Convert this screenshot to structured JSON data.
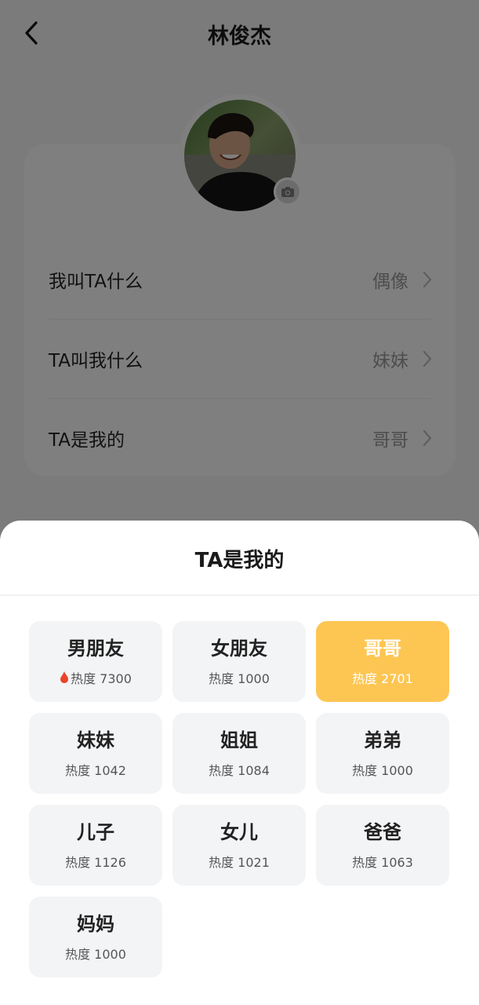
{
  "header": {
    "title": "林俊杰"
  },
  "profile": {
    "rows": [
      {
        "label": "我叫TA什么",
        "value": "偶像"
      },
      {
        "label": "TA叫我什么",
        "value": "妹妹"
      },
      {
        "label": "TA是我的",
        "value": "哥哥"
      }
    ]
  },
  "sheet": {
    "title": "TA是我的",
    "options": [
      {
        "name": "男朋友",
        "heat": "热度 7300",
        "hot": true,
        "selected": false
      },
      {
        "name": "女朋友",
        "heat": "热度 1000",
        "hot": false,
        "selected": false
      },
      {
        "name": "哥哥",
        "heat": "热度 2701",
        "hot": false,
        "selected": true
      },
      {
        "name": "妹妹",
        "heat": "热度 1042",
        "hot": false,
        "selected": false
      },
      {
        "name": "姐姐",
        "heat": "热度 1084",
        "hot": false,
        "selected": false
      },
      {
        "name": "弟弟",
        "heat": "热度 1000",
        "hot": false,
        "selected": false
      },
      {
        "name": "儿子",
        "heat": "热度 1126",
        "hot": false,
        "selected": false
      },
      {
        "name": "女儿",
        "heat": "热度 1021",
        "hot": false,
        "selected": false
      },
      {
        "name": "爸爸",
        "heat": "热度 1063",
        "hot": false,
        "selected": false
      },
      {
        "name": "妈妈",
        "heat": "热度 1000",
        "hot": false,
        "selected": false
      }
    ]
  },
  "colors": {
    "accent": "#fdc653",
    "flame": "#e8452c"
  },
  "icons": {
    "back": "chevron-left-icon",
    "camera": "camera-icon",
    "row_arrow": "chevron-right-icon",
    "hot": "flame-icon"
  }
}
